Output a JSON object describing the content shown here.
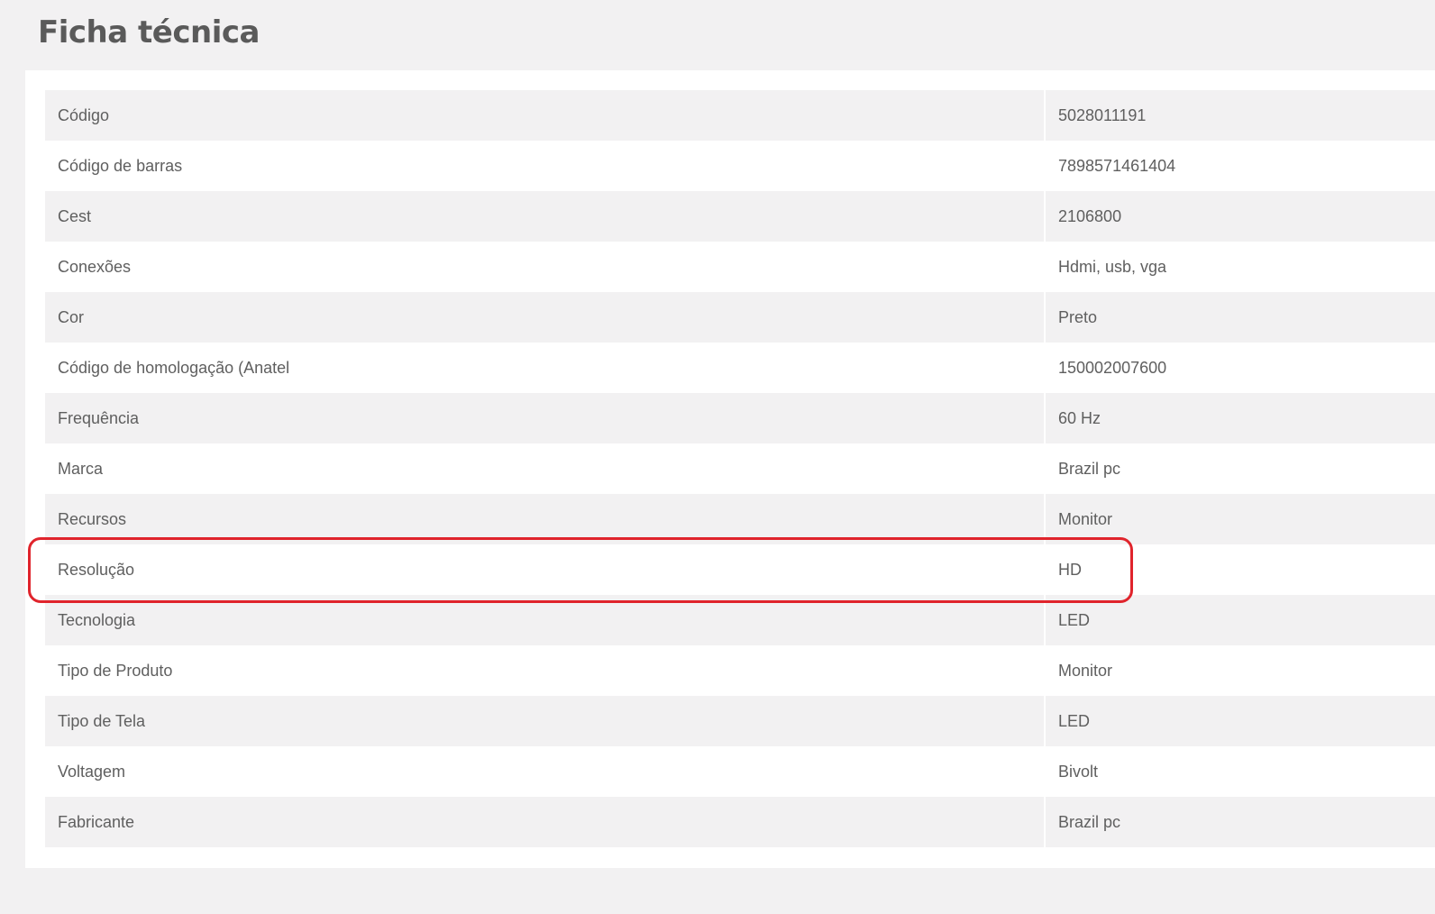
{
  "page": {
    "title": "Ficha técnica"
  },
  "colors": {
    "background": "#f2f1f2",
    "panel": "#ffffff",
    "highlight": "#e0242c",
    "text": "#5f5f5f"
  },
  "specs": [
    {
      "label": "Código",
      "value": "5028011191"
    },
    {
      "label": "Código de barras",
      "value": "7898571461404"
    },
    {
      "label": "Cest",
      "value": "2106800"
    },
    {
      "label": "Conexões",
      "value": "Hdmi, usb, vga"
    },
    {
      "label": "Cor",
      "value": "Preto"
    },
    {
      "label": "Código de homologação (Anatel",
      "value": "150002007600"
    },
    {
      "label": "Frequência",
      "value": "60 Hz"
    },
    {
      "label": "Marca",
      "value": "Brazil pc"
    },
    {
      "label": "Recursos",
      "value": "Monitor"
    },
    {
      "label": "Resolução",
      "value": "HD"
    },
    {
      "label": "Tecnologia",
      "value": "LED"
    },
    {
      "label": "Tipo de Produto",
      "value": "Monitor"
    },
    {
      "label": "Tipo de Tela",
      "value": "LED"
    },
    {
      "label": "Voltagem",
      "value": "Bivolt"
    },
    {
      "label": "Fabricante",
      "value": "Brazil pc"
    }
  ]
}
